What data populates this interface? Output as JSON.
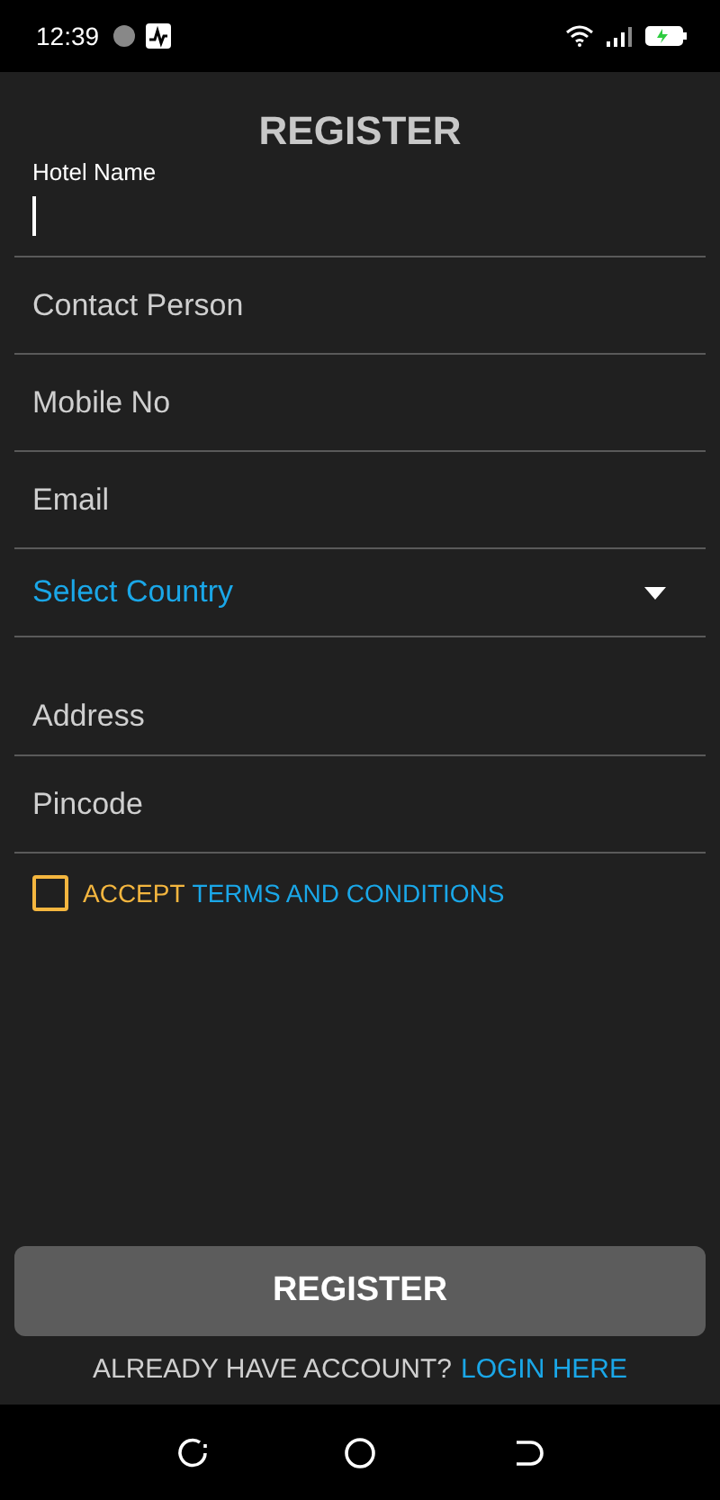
{
  "status_bar": {
    "time": "12:39"
  },
  "title": "REGISTER",
  "fields": [
    {
      "kind": "focused",
      "label": "Hotel Name"
    },
    {
      "kind": "text",
      "placeholder": "Contact Person"
    },
    {
      "kind": "text",
      "placeholder": "Mobile No"
    },
    {
      "kind": "text",
      "placeholder": "Email"
    },
    {
      "kind": "select",
      "placeholder": "Select Country"
    },
    {
      "kind": "text",
      "placeholder": "Address"
    },
    {
      "kind": "text",
      "placeholder": "Pincode"
    }
  ],
  "terms": {
    "checked": false,
    "prefix": "ACCEPT",
    "link": "TERMS AND CONDITIONS"
  },
  "register_button": "REGISTER",
  "login": {
    "prompt": "ALREADY HAVE ACCOUNT?",
    "link": "LOGIN HERE"
  }
}
